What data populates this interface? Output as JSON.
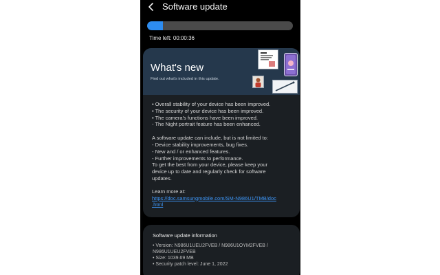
{
  "header": {
    "title": "Software update",
    "back_icon": "chevron-left-icon"
  },
  "progress": {
    "fraction": 0.11,
    "time_left": "Time left: 00:00:36"
  },
  "whats_new": {
    "title": "What's new",
    "subtitle": "Find out what's included in this update.",
    "lines": [
      "• Overall stability of your device has been improved.",
      "• The security of your device has been improved.",
      "• The camera's functions have been improved.",
      " - The Night portrait feature has been enhanced."
    ],
    "general_lines": [
      "A software update can include, but is not limited to:",
      " - Device stability improvements, bug fixes.",
      " - New and / or enhanced features.",
      " - Further improvements to performance.",
      "To get the best from your device, please keep your",
      "device up to date and regularly check for software",
      "updates."
    ],
    "learn_more": "Learn more at:",
    "link_line1": "https://doc.samsungmobile.com/SM-N986U1/TMB/doc",
    "link_line2": ".html"
  },
  "info": {
    "title": "Software update information",
    "lines": [
      "• Version: N986U1UEU2FVEB / N986U1OYM2FVEB /",
      "  N986U1UEU2FVEB",
      "• Size: 1039.69 MB",
      "• Security patch level: June 1, 2022"
    ]
  },
  "colors": {
    "accent": "#2d8cf0",
    "link": "#3d95f5",
    "card": "#1b1f23",
    "banner": "#25384c"
  }
}
